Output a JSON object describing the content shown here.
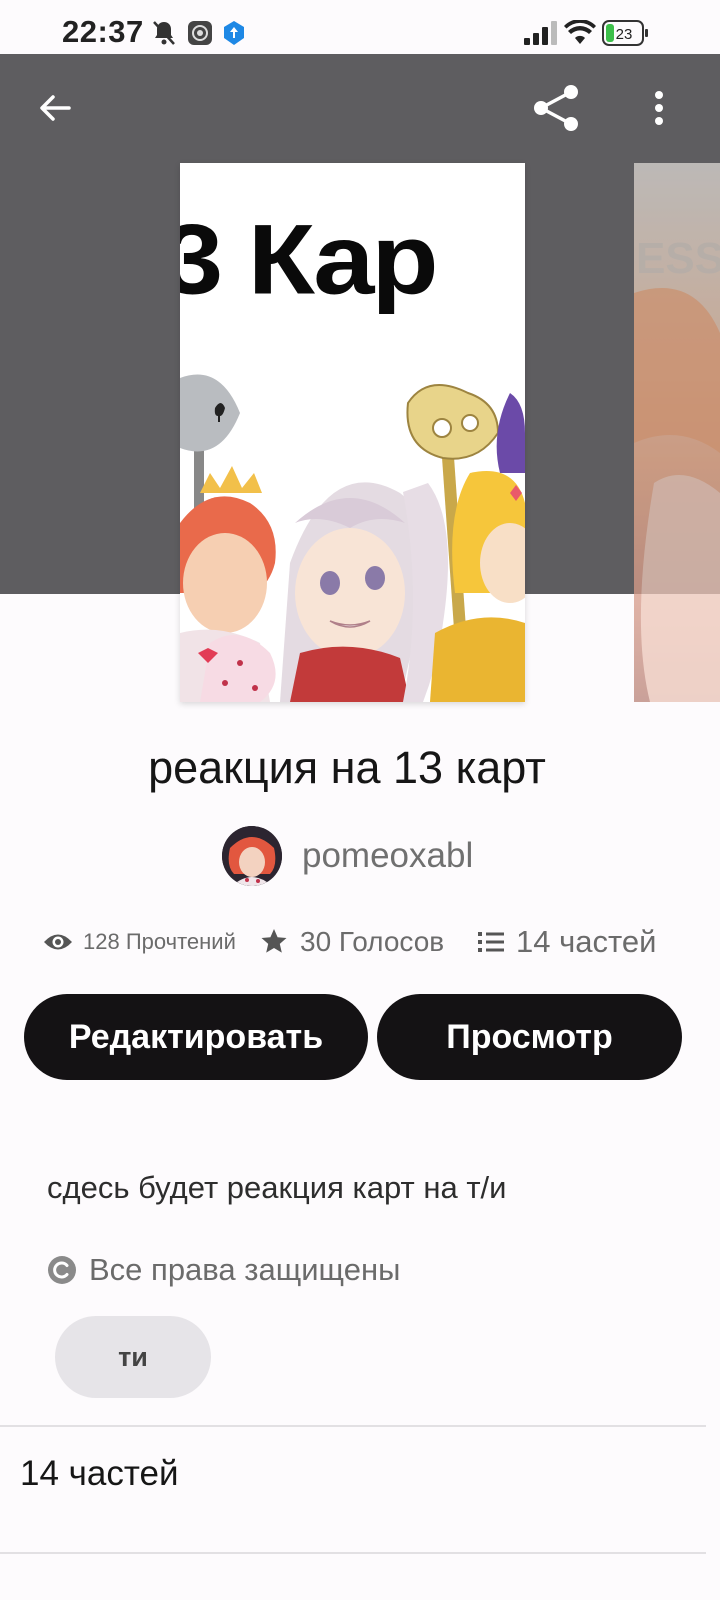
{
  "status_bar": {
    "time": "22:37",
    "icons": [
      "mute-bell-icon",
      "app-notification-icon",
      "location-badge-icon",
      "signal-icon",
      "wifi-icon",
      "battery-icon"
    ],
    "battery_level": "23"
  },
  "toolbar": {
    "back_icon": "arrow-left-icon",
    "share_icon": "share-icon",
    "more_icon": "more-vertical-icon"
  },
  "cover": {
    "title_text": "3 Кар"
  },
  "story": {
    "title": "реакция на 13 карт",
    "author": "pomeoxabl",
    "stats": {
      "reads": "128 Прочтений",
      "votes": "30 Голосов",
      "parts": "14 частей"
    },
    "description": "сдесь будет реакция карт на т/и",
    "rights": "Все права защищены",
    "tag": "ти"
  },
  "actions": {
    "edit_label": "Редактировать",
    "view_label": "Просмотр"
  },
  "toc": {
    "title": "14 частей"
  },
  "colors": {
    "hero_background": "#5e5d60",
    "button_background": "#141214",
    "tag_background": "#e6e4e8"
  }
}
